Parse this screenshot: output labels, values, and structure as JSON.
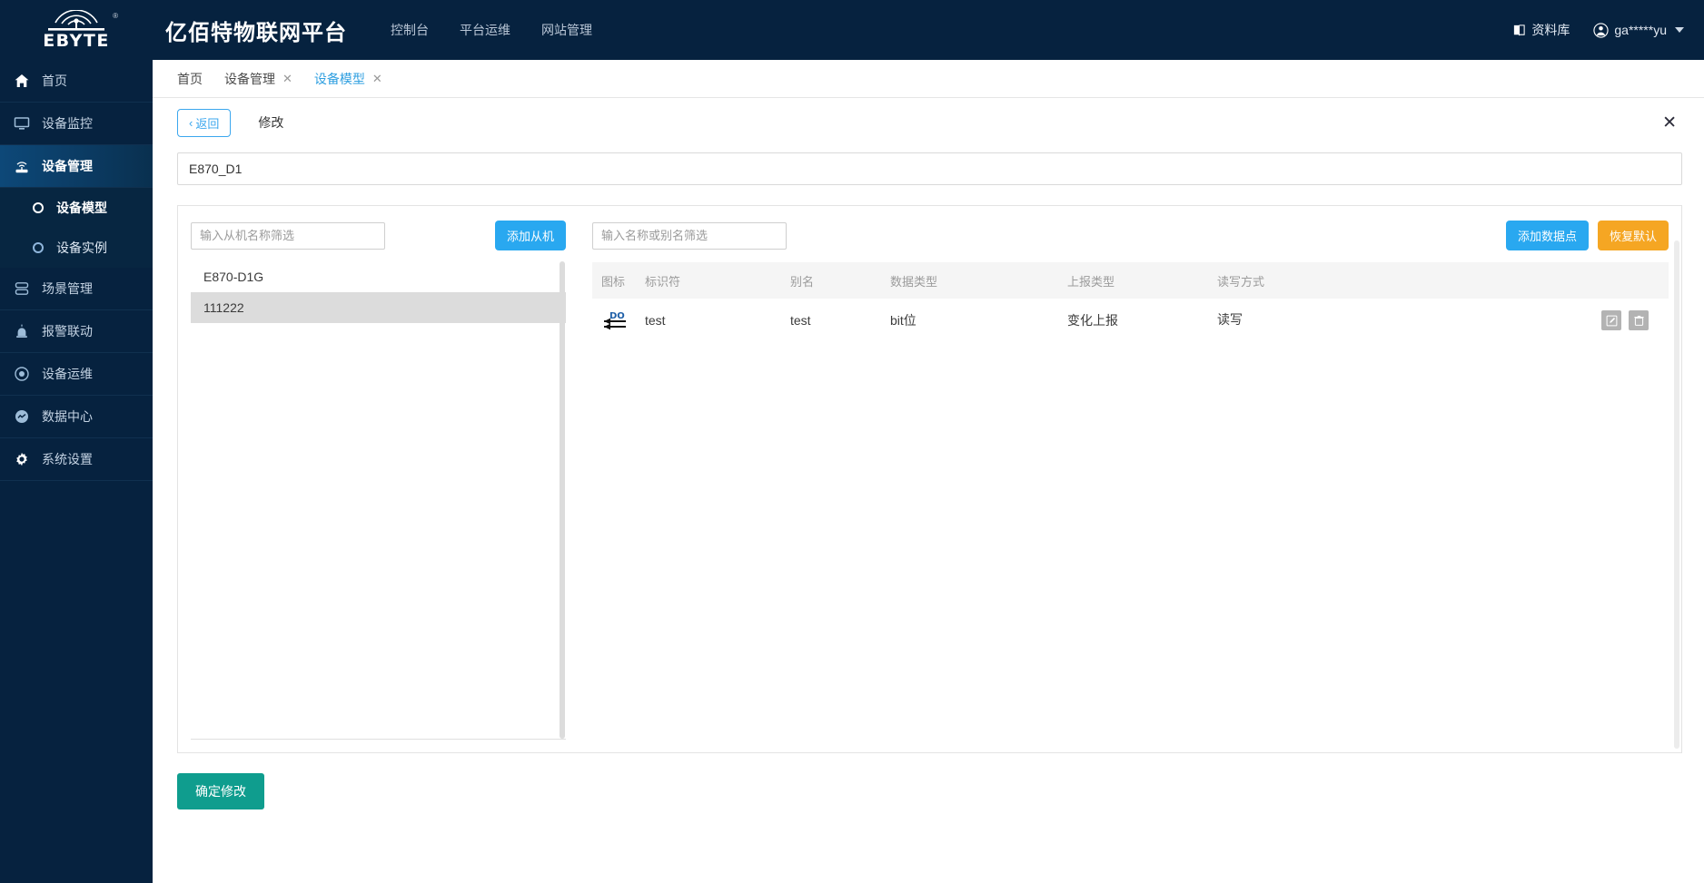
{
  "header": {
    "logo_text": "EBYTE",
    "logo_reg": "®",
    "site_title": "亿佰特物联网平台",
    "nav": [
      {
        "label": "控制台"
      },
      {
        "label": "平台运维"
      },
      {
        "label": "网站管理"
      }
    ],
    "docs_label": "资料库",
    "user_label": "ga*****yu"
  },
  "sidebar": {
    "items": [
      {
        "label": "首页",
        "icon": "home-icon",
        "active": false
      },
      {
        "label": "设备监控",
        "icon": "monitor-icon",
        "active": false
      },
      {
        "label": "设备管理",
        "icon": "router-icon",
        "active": true
      },
      {
        "label": "场景管理",
        "icon": "layers-icon",
        "active": false
      },
      {
        "label": "报警联动",
        "icon": "alarm-icon",
        "active": false
      },
      {
        "label": "设备运维",
        "icon": "target-icon",
        "active": false
      },
      {
        "label": "数据中心",
        "icon": "chart-circle-icon",
        "active": false
      },
      {
        "label": "系统设置",
        "icon": "gear-icon",
        "active": false
      }
    ],
    "sub_items": [
      {
        "label": "设备模型",
        "current": true
      },
      {
        "label": "设备实例",
        "current": false
      }
    ]
  },
  "tabs": [
    {
      "label": "首页",
      "closable": false,
      "active": false
    },
    {
      "label": "设备管理",
      "closable": true,
      "active": false
    },
    {
      "label": "设备模型",
      "closable": true,
      "active": true
    }
  ],
  "toolbar": {
    "back_label": "返回",
    "back_chevron": "‹",
    "title": "修改",
    "close_glyph": "✕"
  },
  "model": {
    "name_value": "E870_D1",
    "name_placeholder": ""
  },
  "slave_panel": {
    "filter_placeholder": "输入从机名称筛选",
    "filter_value": "",
    "add_button": "添加从机",
    "items": [
      {
        "label": "E870-D1G",
        "selected": false
      },
      {
        "label": "111222",
        "selected": true
      }
    ]
  },
  "datapoint_panel": {
    "filter_placeholder": "输入名称或别名筛选",
    "filter_value": "",
    "add_button": "添加数据点",
    "reset_button": "恢复默认",
    "columns": [
      "图标",
      "标识符",
      "别名",
      "数据类型",
      "上报类型",
      "读写方式"
    ],
    "rows": [
      {
        "icon": "DO",
        "identifier": "test",
        "alias": "test",
        "data_type": "bit位",
        "report_type": "变化上报",
        "rw_mode": "读写",
        "edit_icon": "edit-icon",
        "delete_icon": "trash-icon"
      }
    ]
  },
  "footer": {
    "confirm_label": "确定修改"
  },
  "colors": {
    "brand_dark": "#06223f",
    "accent_blue": "#29a8f0",
    "accent_orange": "#f5a623",
    "accent_teal": "#0f9d8e",
    "tab_active": "#2f9fe0"
  }
}
